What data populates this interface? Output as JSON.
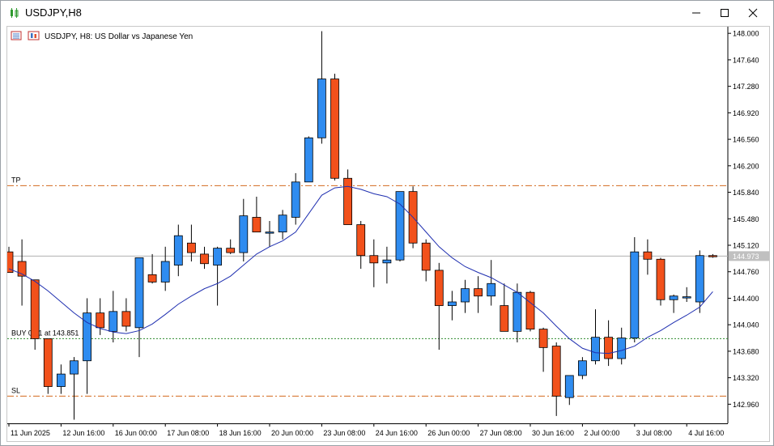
{
  "window": {
    "title": "USDJPY,H8",
    "minimize_icon": "minimize-icon",
    "maximize_icon": "maximize-icon",
    "close_icon": "close-icon"
  },
  "chart_header": {
    "text": "USDJPY, H8:  US Dollar vs Japanese Yen"
  },
  "colors": {
    "bull": "#2f8cf0",
    "bear": "#f2511b",
    "ma": "#1f2fb0",
    "tp_sl": "#d2691e",
    "buy": "#2e8b2e",
    "bid": "#b0b0b0",
    "bid_label_bg": "#c0c0c0"
  },
  "chart_data": {
    "type": "candlestick",
    "symbol": "USDJPY",
    "timeframe": "H8",
    "ylim": [
      142.7,
      148.09
    ],
    "y_ticks": [
      "148.000",
      "147.640",
      "147.280",
      "146.920",
      "146.560",
      "146.200",
      "145.840",
      "145.480",
      "145.120",
      "144.760",
      "144.400",
      "144.040",
      "143.680",
      "143.320",
      "142.960"
    ],
    "x_labels": [
      {
        "index": 0,
        "label": "11 Jun 2025"
      },
      {
        "index": 4,
        "label": "12 Jun 16:00"
      },
      {
        "index": 8,
        "label": "16 Jun 00:00"
      },
      {
        "index": 12,
        "label": "17 Jun 08:00"
      },
      {
        "index": 16,
        "label": "18 Jun 16:00"
      },
      {
        "index": 20,
        "label": "20 Jun 00:00"
      },
      {
        "index": 24,
        "label": "23 Jun 08:00"
      },
      {
        "index": 28,
        "label": "24 Jun 16:00"
      },
      {
        "index": 32,
        "label": "26 Jun 00:00"
      },
      {
        "index": 36,
        "label": "27 Jun 08:00"
      },
      {
        "index": 40,
        "label": "30 Jun 16:00"
      },
      {
        "index": 44,
        "label": "2 Jul 00:00"
      },
      {
        "index": 48,
        "label": "3 Jul 08:00"
      },
      {
        "index": 52,
        "label": "4 Jul 16:00"
      }
    ],
    "candles": [
      {
        "o": 145.03,
        "h": 145.1,
        "l": 144.75,
        "c": 144.75
      },
      {
        "o": 144.9,
        "h": 145.2,
        "l": 144.3,
        "c": 144.7
      },
      {
        "o": 144.65,
        "h": 144.65,
        "l": 143.7,
        "c": 143.85
      },
      {
        "o": 143.85,
        "h": 143.85,
        "l": 143.1,
        "c": 143.2
      },
      {
        "o": 143.2,
        "h": 143.5,
        "l": 143.1,
        "c": 143.37
      },
      {
        "o": 143.37,
        "h": 143.6,
        "l": 142.75,
        "c": 143.55
      },
      {
        "o": 143.55,
        "h": 144.4,
        "l": 143.1,
        "c": 144.2
      },
      {
        "o": 144.2,
        "h": 144.4,
        "l": 143.9,
        "c": 144.0
      },
      {
        "o": 143.95,
        "h": 144.5,
        "l": 143.8,
        "c": 144.22
      },
      {
        "o": 144.22,
        "h": 144.4,
        "l": 143.95,
        "c": 144.02
      },
      {
        "o": 144.0,
        "h": 144.9,
        "l": 143.6,
        "c": 144.95
      },
      {
        "o": 144.72,
        "h": 145.0,
        "l": 144.6,
        "c": 144.62
      },
      {
        "o": 144.62,
        "h": 145.1,
        "l": 144.5,
        "c": 144.9
      },
      {
        "o": 144.85,
        "h": 145.4,
        "l": 144.7,
        "c": 145.25
      },
      {
        "o": 145.15,
        "h": 145.4,
        "l": 144.9,
        "c": 145.02
      },
      {
        "o": 145.0,
        "h": 145.1,
        "l": 144.8,
        "c": 144.87
      },
      {
        "o": 144.85,
        "h": 145.1,
        "l": 144.3,
        "c": 145.08
      },
      {
        "o": 145.08,
        "h": 145.2,
        "l": 145.0,
        "c": 145.02
      },
      {
        "o": 145.02,
        "h": 145.75,
        "l": 144.9,
        "c": 145.52
      },
      {
        "o": 145.5,
        "h": 145.78,
        "l": 145.3,
        "c": 145.3
      },
      {
        "o": 145.3,
        "h": 145.45,
        "l": 145.1,
        "c": 145.3
      },
      {
        "o": 145.3,
        "h": 145.6,
        "l": 145.2,
        "c": 145.53
      },
      {
        "o": 145.5,
        "h": 146.1,
        "l": 145.4,
        "c": 145.98
      },
      {
        "o": 145.98,
        "h": 146.6,
        "l": 146.15,
        "c": 146.58
      },
      {
        "o": 146.58,
        "h": 148.03,
        "l": 146.5,
        "c": 147.38
      },
      {
        "o": 147.38,
        "h": 147.45,
        "l": 146.0,
        "c": 146.03
      },
      {
        "o": 146.03,
        "h": 146.15,
        "l": 145.4,
        "c": 145.4
      },
      {
        "o": 145.4,
        "h": 145.45,
        "l": 144.8,
        "c": 144.98
      },
      {
        "o": 144.98,
        "h": 145.2,
        "l": 144.55,
        "c": 144.88
      },
      {
        "o": 144.88,
        "h": 145.1,
        "l": 144.6,
        "c": 144.92
      },
      {
        "o": 144.92,
        "h": 145.84,
        "l": 144.9,
        "c": 145.85
      },
      {
        "o": 145.85,
        "h": 145.92,
        "l": 145.08,
        "c": 145.15
      },
      {
        "o": 145.15,
        "h": 145.2,
        "l": 144.63,
        "c": 144.78
      },
      {
        "o": 144.78,
        "h": 144.88,
        "l": 143.7,
        "c": 144.3
      },
      {
        "o": 144.3,
        "h": 144.5,
        "l": 144.1,
        "c": 144.35
      },
      {
        "o": 144.35,
        "h": 144.65,
        "l": 144.2,
        "c": 144.53
      },
      {
        "o": 144.53,
        "h": 144.7,
        "l": 144.2,
        "c": 144.43
      },
      {
        "o": 144.43,
        "h": 144.92,
        "l": 144.3,
        "c": 144.6
      },
      {
        "o": 144.3,
        "h": 144.6,
        "l": 143.95,
        "c": 143.95
      },
      {
        "o": 143.95,
        "h": 144.6,
        "l": 143.8,
        "c": 144.48
      },
      {
        "o": 144.48,
        "h": 144.5,
        "l": 143.95,
        "c": 143.98
      },
      {
        "o": 143.98,
        "h": 144.0,
        "l": 143.4,
        "c": 143.73
      },
      {
        "o": 143.75,
        "h": 143.8,
        "l": 142.8,
        "c": 143.07
      },
      {
        "o": 143.05,
        "h": 143.35,
        "l": 142.95,
        "c": 143.35
      },
      {
        "o": 143.35,
        "h": 143.6,
        "l": 143.3,
        "c": 143.55
      },
      {
        "o": 143.55,
        "h": 144.25,
        "l": 143.5,
        "c": 143.87
      },
      {
        "o": 143.87,
        "h": 144.1,
        "l": 143.48,
        "c": 143.58
      },
      {
        "o": 143.58,
        "h": 144.0,
        "l": 143.5,
        "c": 143.86
      },
      {
        "o": 143.86,
        "h": 145.23,
        "l": 143.8,
        "c": 145.03
      },
      {
        "o": 145.03,
        "h": 145.2,
        "l": 144.72,
        "c": 144.93
      },
      {
        "o": 144.93,
        "h": 144.95,
        "l": 144.3,
        "c": 144.38
      },
      {
        "o": 144.38,
        "h": 144.45,
        "l": 144.2,
        "c": 144.43
      },
      {
        "o": 144.42,
        "h": 144.55,
        "l": 144.35,
        "c": 144.42
      },
      {
        "o": 144.35,
        "h": 145.05,
        "l": 144.2,
        "c": 144.98
      },
      {
        "o": 144.98,
        "h": 145.0,
        "l": 144.95,
        "c": 144.97
      }
    ],
    "moving_average": [
      144.8,
      144.73,
      144.63,
      144.5,
      144.35,
      144.2,
      144.07,
      143.99,
      143.94,
      143.92,
      143.96,
      144.05,
      144.18,
      144.32,
      144.43,
      144.53,
      144.6,
      144.7,
      144.85,
      145.0,
      145.1,
      145.18,
      145.3,
      145.55,
      145.8,
      145.9,
      145.92,
      145.88,
      145.82,
      145.78,
      145.68,
      145.5,
      145.3,
      145.1,
      144.95,
      144.83,
      144.75,
      144.68,
      144.58,
      144.48,
      144.34,
      144.2,
      144.02,
      143.85,
      143.72,
      143.66,
      143.65,
      143.69,
      143.75,
      143.87,
      143.96,
      144.07,
      144.17,
      144.28,
      144.49
    ],
    "lines": [
      {
        "name": "TP",
        "label": "TP",
        "value": 145.93,
        "style": "dash-dot"
      },
      {
        "name": "BUY",
        "label": "BUY 0.01 at 143.851",
        "value": 143.851,
        "style": "dotted"
      },
      {
        "name": "SL",
        "label": "SL",
        "value": 143.07,
        "style": "dash-dot"
      }
    ],
    "bid": {
      "value": 144.973,
      "label": "144.973"
    }
  }
}
